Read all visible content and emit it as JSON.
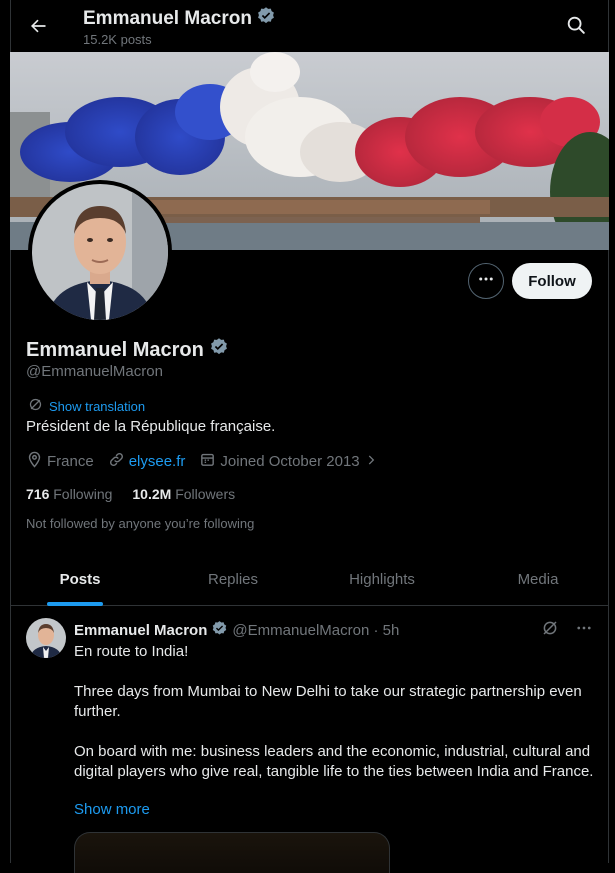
{
  "topbar": {
    "name": "Emmanuel Macron",
    "posts": "15.2K posts"
  },
  "profile": {
    "name": "Emmanuel Macron",
    "handle": "@EmmanuelMacron",
    "translate": "Show translation",
    "bio": "Président de la République française.",
    "location": "France",
    "website": "elysee.fr",
    "joined": "Joined October 2013",
    "following_count": "716",
    "following_label": "Following",
    "followers_count": "10.2M",
    "followers_label": "Followers",
    "not_followed": "Not followed by anyone you’re following",
    "follow_label": "Follow"
  },
  "tabs": [
    {
      "label": "Posts"
    },
    {
      "label": "Replies"
    },
    {
      "label": "Highlights"
    },
    {
      "label": "Media"
    }
  ],
  "post": {
    "name": "Emmanuel Macron",
    "handle_time": "@EmmanuelMacron · 5h",
    "line1": "En route to India!",
    "para2": "Three days from Mumbai to New Delhi to take our strategic partnership even further.",
    "para3": "On board with me: business leaders and the economic, industrial, cultural and digital players who give real, tangible life to the ties between India and France.",
    "show_more": "Show more"
  },
  "colors": {
    "accent": "#1d9bf0",
    "verified": "#829aab",
    "muted": "#71767b",
    "text": "#e7e9ea"
  }
}
